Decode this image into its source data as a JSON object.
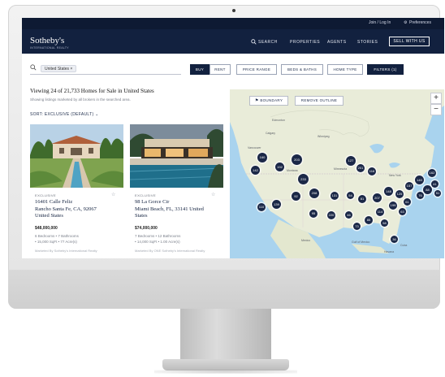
{
  "topbar": {
    "login": "Join / Log In",
    "preferences": "Preferences"
  },
  "brand": {
    "name": "Sotheby's",
    "tagline": "INTERNATIONAL REALTY"
  },
  "nav": {
    "search": "SEARCH",
    "properties": "PROPERTIES",
    "agents": "AGENTS",
    "stories": "STORIES",
    "sell": "SELL WITH US"
  },
  "search": {
    "chip": "United States ×"
  },
  "filters": {
    "buy": "BUY",
    "rent": "RENT",
    "price": "PRICE RANGE",
    "beds": "BEDS & BATHS",
    "home": "HOME TYPE",
    "more": "FILTERS (1)"
  },
  "results": {
    "heading": "Viewing 24 of 21,733 Homes for Sale in United States",
    "subheading": "Showing listings marketed by all brokers in the searched area.",
    "sort": "SORT: EXCLUSIVE (DEFAULT) ⌄"
  },
  "listings": [
    {
      "tag": "EXCLUSIVE",
      "address1": "16401 Calle Feliz",
      "address2": "Rancho Santa Fe, CA, 92067",
      "address3": "United States",
      "price": "$48,000,000",
      "spec1": "6 Bedrooms • 7 Bathrooms",
      "spec2": "• 15,000 SqFt • 77 Acre(s)",
      "broker": "Marketed By Sotheby's International Realty"
    },
    {
      "tag": "EXCLUSIVE",
      "address1": "98 La Gorce Cir",
      "address2": "Miami Beach, FL, 33141 United",
      "address3": "States",
      "price": "$74,000,000",
      "spec1": "7 Bedrooms • 12 Bathrooms",
      "spec2": "• 14,000 SqFt • 1.00 Acre(s)",
      "broker": "Marketed By ONE Sotheby's International Realty"
    }
  ],
  "map": {
    "boundary": "BOUNDARY",
    "remove_outline": "REMOVE OUTLINE",
    "zoom_in": "+",
    "zoom_out": "−",
    "cities": [
      "Edmonton",
      "Calgary",
      "Winnipeg",
      "Vancouver",
      "Montana",
      "Minnesota",
      "New York",
      "Mexico",
      "Gulf of Mexico",
      "Havana",
      "Cuba"
    ],
    "clusters": [
      "160",
      "203",
      "192",
      "142",
      "233",
      "127",
      "201",
      "116",
      "208",
      "92",
      "139",
      "110",
      "131",
      "54",
      "81",
      "207",
      "148",
      "125",
      "157",
      "140",
      "88",
      "76",
      "61",
      "199",
      "63",
      "114",
      "41",
      "162",
      "85",
      "73",
      "58",
      "220",
      "95",
      "46",
      "36",
      "51"
    ],
    "colors": {
      "land": "#e9ecd9",
      "water": "#a9d3ee",
      "cluster": "#1b2847"
    }
  }
}
